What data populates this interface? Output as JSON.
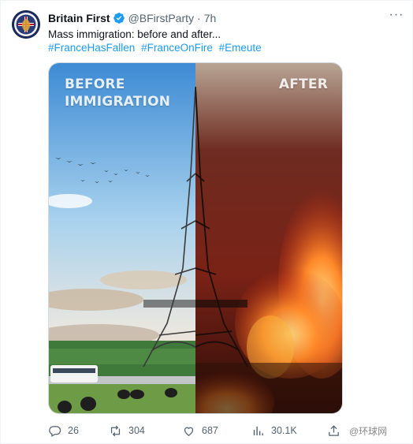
{
  "author": {
    "display_name": "Britain First",
    "handle": "@BFirstParty",
    "separator": "·",
    "time": "7h",
    "verified_color": "#1d9bf0"
  },
  "tweet": {
    "text": "Mass immigration: before and after...",
    "hashtags": [
      "#FranceHasFallen",
      "#FranceOnFire",
      "#Emeute"
    ]
  },
  "media": {
    "before_label": "BEFORE IMMIGRATION",
    "after_label": "AFTER"
  },
  "actions": {
    "replies": "26",
    "reposts": "304",
    "likes": "687",
    "views": "30.1K"
  },
  "watermark": "@环球网",
  "colors": {
    "link": "#1d9bf0",
    "muted": "#536471"
  }
}
